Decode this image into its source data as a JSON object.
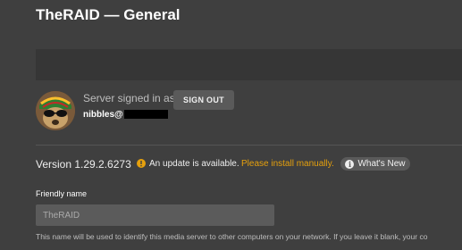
{
  "header": {
    "title": "TheRAID — General"
  },
  "account": {
    "signed_in_label": "Server signed in as",
    "username": "nibbles@",
    "sign_out_label": "SIGN OUT"
  },
  "version": {
    "label": "Version 1.29.2.6273",
    "update_text": "An update is available.",
    "install_link": "Please install manually.",
    "whats_new_label": "What's New"
  },
  "friendly_name": {
    "label": "Friendly name",
    "value": "TheRAID",
    "help": "This name will be used to identify this media server to other computers on your network. If you leave it blank, your co"
  },
  "colors": {
    "background": "#3f3f3f",
    "accent": "#e5a00d",
    "button": "#5a5a5a"
  },
  "icons": {
    "warning": "warning-icon",
    "info": "info-icon"
  }
}
